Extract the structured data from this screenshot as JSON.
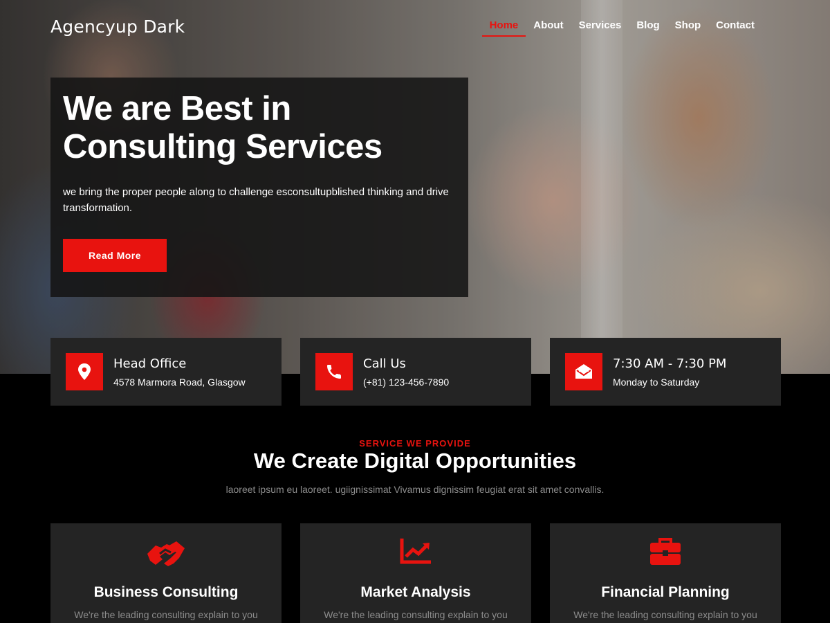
{
  "brand": {
    "logo": "Agencyup Dark",
    "accent": "#e8130f"
  },
  "nav": {
    "items": [
      {
        "label": "Home",
        "active": true
      },
      {
        "label": "About"
      },
      {
        "label": "Services"
      },
      {
        "label": "Blog"
      },
      {
        "label": "Shop"
      },
      {
        "label": "Contact"
      }
    ]
  },
  "hero": {
    "title_line1": "We are Best in",
    "title_line2": "Consulting Services",
    "description": "we bring the proper people along to challenge esconsultupblished thinking and drive transformation.",
    "button_label": "Read More"
  },
  "info_cards": [
    {
      "icon": "location-pin-icon",
      "title": "Head Office",
      "subtitle": "4578 Marmora Road, Glasgow"
    },
    {
      "icon": "phone-icon",
      "title": "Call Us",
      "subtitle": "(+81) 123-456-7890"
    },
    {
      "icon": "envelope-open-icon",
      "title": "7:30 AM - 7:30 PM",
      "subtitle": "Monday to Saturday"
    }
  ],
  "services": {
    "eyebrow": "SERVICE WE PROVIDE",
    "title": "We Create Digital Opportunities",
    "description": "laoreet ipsum eu laoreet. ugiignissimat Vivamus dignissim feugiat erat sit amet convallis.",
    "cards": [
      {
        "icon": "handshake-icon",
        "title": "Business Consulting",
        "description": "We're the leading consulting explain to you"
      },
      {
        "icon": "chart-line-icon",
        "title": "Market Analysis",
        "description": "We're the leading consulting explain to you"
      },
      {
        "icon": "briefcase-icon",
        "title": "Financial Planning",
        "description": "We're the leading consulting explain to you"
      }
    ]
  }
}
